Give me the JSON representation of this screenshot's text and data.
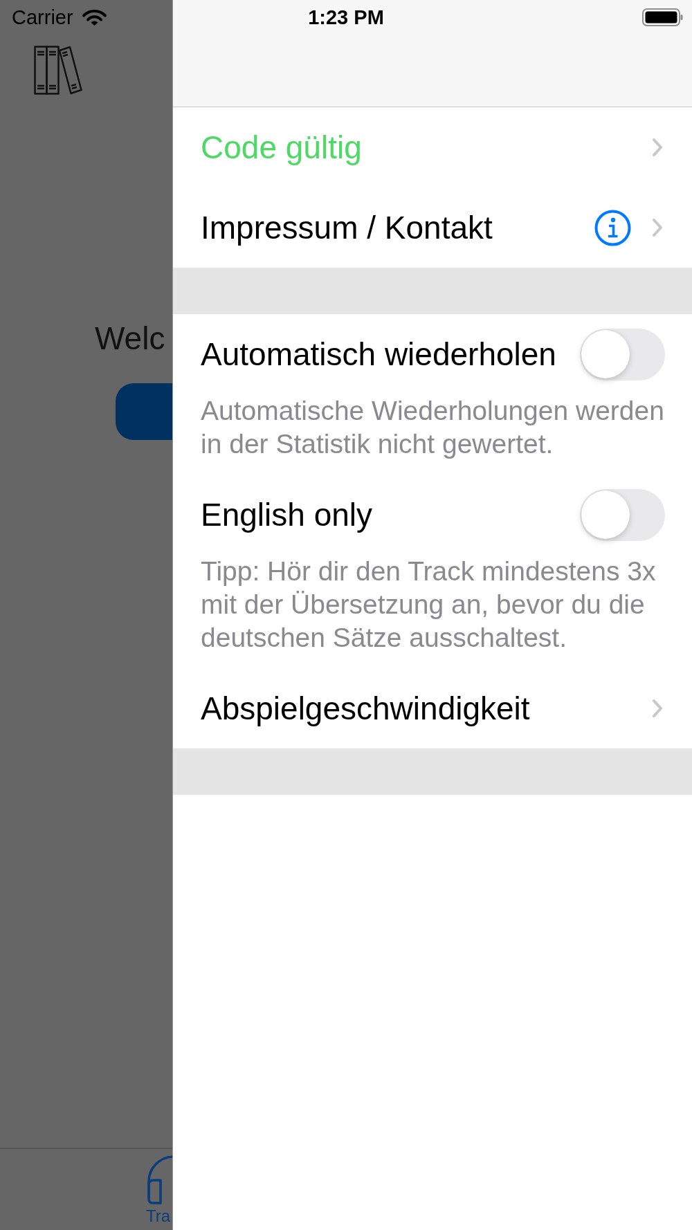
{
  "status_bar": {
    "carrier": "Carrier",
    "time": "1:23 PM"
  },
  "background_app": {
    "heading": "Welc",
    "tab_bar": {
      "tabs": [
        {
          "label": "Tra",
          "selected": true
        }
      ]
    }
  },
  "menu": {
    "sections": [
      {
        "rows": [
          {
            "kind": "link",
            "label": "Code gültig",
            "color": "#4cd964"
          },
          {
            "kind": "link_info",
            "label": "Impressum / Kontakt"
          }
        ]
      },
      {
        "rows": [
          {
            "kind": "switch",
            "label": "Automatisch wiederholen",
            "on": false,
            "note": "Automatische Wiederholungen werden in der Statistik nicht gewertet."
          },
          {
            "kind": "switch",
            "label": "English only",
            "on": false,
            "note": "Tipp: Hör dir den Track mindestens 3x mit der Übersetzung an, bevor du die deutschen Sätze ausschaltest."
          },
          {
            "kind": "link",
            "label": "Abspielgeschwindigkeit"
          }
        ]
      }
    ]
  }
}
